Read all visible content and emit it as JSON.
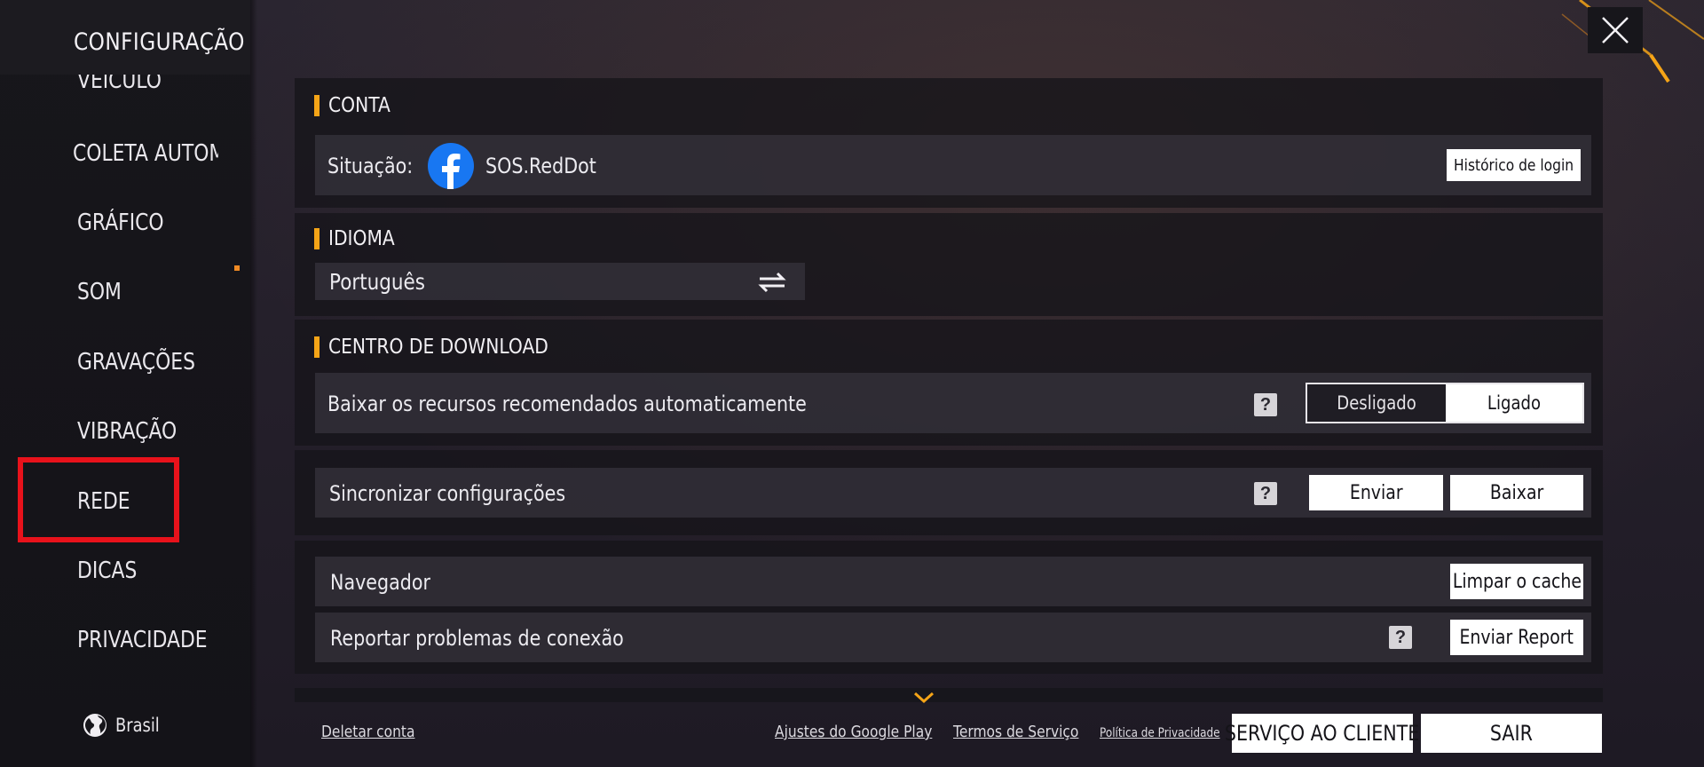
{
  "sidebar": {
    "title": "CONFIGURAÇÃO",
    "items": [
      {
        "label": "VEÍCULO"
      },
      {
        "label": "COLETA AUTOMÁTICA"
      },
      {
        "label": "GRÁFICO"
      },
      {
        "label": "SOM"
      },
      {
        "label": "GRAVAÇÕES"
      },
      {
        "label": "VIBRAÇÃO"
      },
      {
        "label": "REDE"
      },
      {
        "label": "DICAS"
      },
      {
        "label": "PRIVACIDADE"
      }
    ],
    "region": "Brasil",
    "region_icon": "globe-icon"
  },
  "conta": {
    "heading": "CONTA",
    "status_label": "Situação:",
    "account_name": "SOS.RedDot",
    "account_icon": "facebook-icon",
    "login_history_button": "Histórico de login"
  },
  "idioma": {
    "heading": "IDIOMA",
    "selected_language": "Português",
    "switch_icon": "swap-arrows-icon"
  },
  "download_center": {
    "heading": "CENTRO DE DOWNLOAD",
    "auto_download_label": "Baixar os recursos recomendados automaticamente",
    "toggle_off": "Desligado",
    "toggle_on": "Ligado",
    "toggle_state": "Ligado"
  },
  "sync": {
    "label": "Sincronizar configurações",
    "upload_button": "Enviar",
    "download_button": "Baixar"
  },
  "browser": {
    "label": "Navegador",
    "clear_cache_button": "Limpar o cache"
  },
  "report": {
    "label": "Reportar problemas de conexão",
    "send_button": "Enviar Report"
  },
  "footer": {
    "delete_account": "Deletar conta",
    "google_play": "Ajustes do Google Play",
    "terms": "Termos de Serviço",
    "privacy": "Política de Privacidade",
    "customer_service": "SERVIÇO AO CLIENTE",
    "exit": "SAIR"
  },
  "colors": {
    "accent": "#f5a417",
    "highlight": "#e8121b",
    "facebook": "#1877f2"
  }
}
